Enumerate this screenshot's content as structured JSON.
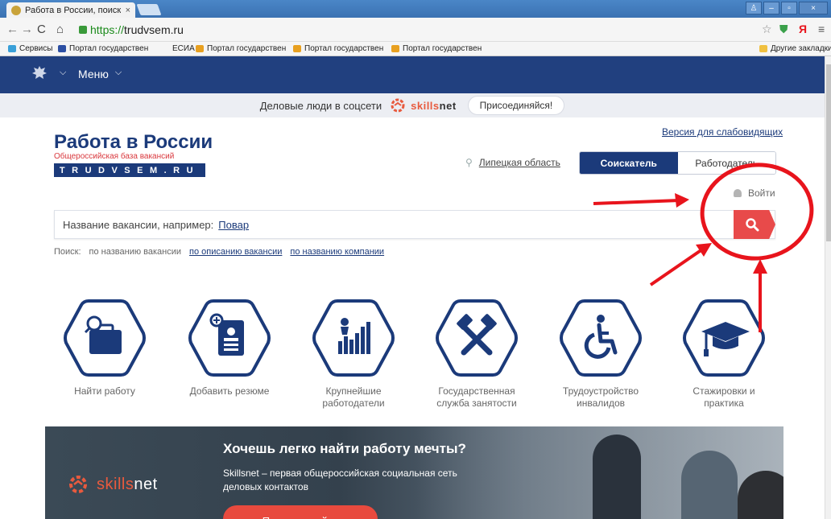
{
  "browser": {
    "tab_title": "Работа в России, поиск ва",
    "tab_close": "×",
    "url_scheme": "https://",
    "url_host": "trudvsem.ru",
    "bookmarks": [
      {
        "label": "Сервисы",
        "color": "#3aa0d8"
      },
      {
        "label": "Портал государствен",
        "color": "#2c4fa3"
      },
      {
        "label": "ЕСИА",
        "color": ""
      },
      {
        "label": "Портал государствен",
        "color": "#e8a020"
      },
      {
        "label": "Портал государствен",
        "color": "#e8a020"
      },
      {
        "label": "Портал государствен",
        "color": "#e8a020"
      }
    ],
    "other_bookmarks": "Другие закладки"
  },
  "site": {
    "menu_label": "Меню",
    "promo_text": "Деловые люди в соцсети",
    "promo_brand_a": "skills",
    "promo_brand_b": "net",
    "promo_join": "Присоединяйся!",
    "logo_title": "Работа в России",
    "logo_subtitle": "Общероссийская база вакансий",
    "logo_domain": "TRUDVSEM.RU",
    "accessibility_link": "Версия для слабовидящих",
    "region": "Липецкая область",
    "role_seeker": "Соискатель",
    "role_employer": "Работодатель",
    "login": "Войти",
    "search_placeholder": "Название вакансии, например:",
    "search_example": "Повар",
    "search_modes_label": "Поиск:",
    "search_mode_title": "по названию вакансии",
    "search_mode_description": "по описанию вакансии",
    "search_mode_company": "по названию компании",
    "categories": [
      {
        "line1": "Найти работу",
        "line2": ""
      },
      {
        "line1": "Добавить резюме",
        "line2": ""
      },
      {
        "line1": "Крупнейшие",
        "line2": "работодатели"
      },
      {
        "line1": "Государственная",
        "line2": "служба занятости"
      },
      {
        "line1": "Трудоустройство",
        "line2": "инвалидов"
      },
      {
        "line1": "Стажировки и",
        "line2": "практика"
      }
    ],
    "banner_title": "Хочешь легко найти работу мечты?",
    "banner_desc": "Skillsnet – первая общероссийская социальная сеть деловых контактов",
    "banner_brand_a": "skills",
    "banner_brand_b": "net",
    "banner_button": "Присоединяйся"
  },
  "colors": {
    "brand_navy": "#1b3a7a",
    "accent_red": "#e84a4a",
    "annotation_red": "#e8141c"
  }
}
